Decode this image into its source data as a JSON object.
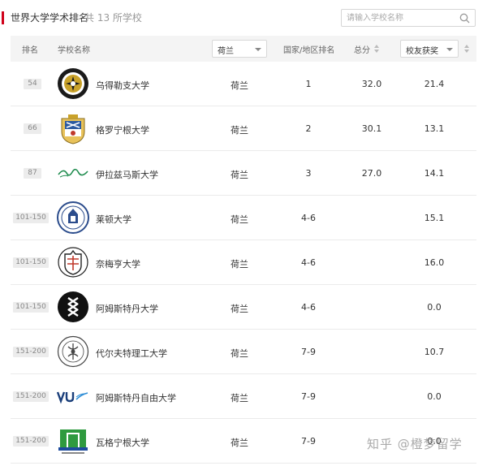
{
  "header": {
    "title": "世界大学学术排名",
    "count": "共 13 所学校",
    "search_placeholder": "请输入学校名称"
  },
  "columns": {
    "rank": "排名",
    "name": "学校名称",
    "country_filter": "荷兰",
    "region_rank": "国家/地区排名",
    "score": "总分",
    "sort_indicator": "校友获奖"
  },
  "rows": [
    {
      "rank": "54",
      "name": "乌得勒支大学",
      "country": "荷兰",
      "region_rank": "1",
      "score": "32.0",
      "alumni": "21.4",
      "logo": "utrecht-seal"
    },
    {
      "rank": "66",
      "name": "格罗宁根大学",
      "country": "荷兰",
      "region_rank": "2",
      "score": "30.1",
      "alumni": "13.1",
      "logo": "groningen-crest"
    },
    {
      "rank": "87",
      "name": "伊拉兹马斯大学",
      "country": "荷兰",
      "region_rank": "3",
      "score": "27.0",
      "alumni": "14.1",
      "logo": "erasmus-script"
    },
    {
      "rank": "101-150",
      "name": "莱顿大学",
      "country": "荷兰",
      "region_rank": "4-6",
      "score": "",
      "alumni": "15.1",
      "logo": "leiden-seal"
    },
    {
      "rank": "101-150",
      "name": "奈梅亨大学",
      "country": "荷兰",
      "region_rank": "4-6",
      "score": "",
      "alumni": "16.0",
      "logo": "nijmegen-seal"
    },
    {
      "rank": "101-150",
      "name": "阿姆斯特丹大学",
      "country": "荷兰",
      "region_rank": "4-6",
      "score": "",
      "alumni": "0.0",
      "logo": "amsterdam-xxx"
    },
    {
      "rank": "151-200",
      "name": "代尔夫特理工大学",
      "country": "荷兰",
      "region_rank": "7-9",
      "score": "",
      "alumni": "10.7",
      "logo": "delft-seal"
    },
    {
      "rank": "151-200",
      "name": "阿姆斯特丹自由大学",
      "country": "荷兰",
      "region_rank": "7-9",
      "score": "",
      "alumni": "0.0",
      "logo": "vu-wordmark"
    },
    {
      "rank": "151-200",
      "name": "瓦格宁根大学",
      "country": "荷兰",
      "region_rank": "7-9",
      "score": "",
      "alumni": "0.0",
      "logo": "wageningen-mark"
    }
  ],
  "watermark": "知乎 @橙梦留学",
  "colors": {
    "accent": "#d0021b",
    "header_bg": "#f4f4f4"
  }
}
